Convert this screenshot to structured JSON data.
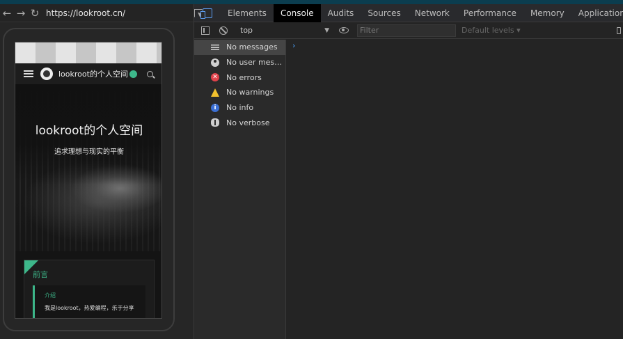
{
  "browser": {
    "url": "https://lookroot.cn/"
  },
  "site": {
    "title": "lookroot的个人空间",
    "hero_title": "lookroot的个人空间",
    "hero_subtitle": "追求理想与现实的平衡",
    "card": {
      "title": "前言",
      "label": "介绍",
      "text": "我是lookroot，热爱编程，乐于分享"
    }
  },
  "devtools": {
    "tabs": [
      {
        "label": "Elements",
        "active": false
      },
      {
        "label": "Console",
        "active": true
      },
      {
        "label": "Audits",
        "active": false
      },
      {
        "label": "Sources",
        "active": false
      },
      {
        "label": "Network",
        "active": false
      },
      {
        "label": "Performance",
        "active": false
      },
      {
        "label": "Memory",
        "active": false
      },
      {
        "label": "Application",
        "active": false
      }
    ],
    "more_tabs": "»",
    "toolbar": {
      "context": "top",
      "filter_placeholder": "Filter",
      "levels": "Default levels ▾"
    },
    "sidebar": [
      {
        "label": "No messages",
        "icon": "list-icon",
        "selected": true
      },
      {
        "label": "No user messages",
        "icon": "user-icon",
        "selected": false
      },
      {
        "label": "No errors",
        "icon": "error-icon",
        "selected": false
      },
      {
        "label": "No warnings",
        "icon": "warning-icon",
        "selected": false
      },
      {
        "label": "No info",
        "icon": "info-icon",
        "selected": false
      },
      {
        "label": "No verbose",
        "icon": "bug-icon",
        "selected": false
      }
    ],
    "prompt": "›"
  },
  "colors": {
    "accent": "#3db78a",
    "devtools_blue": "#5b9cf0",
    "error": "#e0424a",
    "warning": "#f2c12e",
    "info": "#3b6fd3"
  }
}
